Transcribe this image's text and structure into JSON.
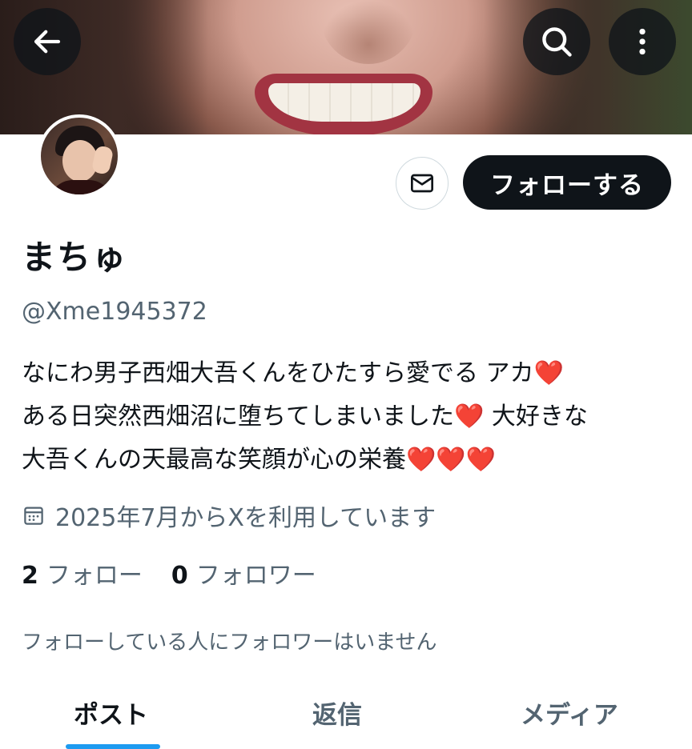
{
  "profile": {
    "name": "まちゅ",
    "handle": "@Xme1945372",
    "follow_button_label": "フォローする",
    "bio_lines": [
      {
        "text": "なにわ男子西畑大吾くんをひたすら愛でる アカ",
        "hearts": "❤️"
      },
      {
        "text": "ある日突然西畑沼に堕ちてしまいました",
        "hearts": "❤️",
        "tail": " 大好きな"
      },
      {
        "text": "大吾くんの天最高な笑顔が心の栄養",
        "hearts": "❤️❤️❤️"
      }
    ],
    "joined": "2025年7月からXを利用しています",
    "following_count": "2",
    "following_label": "フォロー",
    "followers_count": "0",
    "followers_label": "フォロワー",
    "mutual_note": "フォローしている人にフォロワーはいません"
  },
  "tabs": [
    {
      "label": "ポスト",
      "active": true
    },
    {
      "label": "返信",
      "active": false
    },
    {
      "label": "メディア",
      "active": false
    }
  ],
  "colors": {
    "follow_button_bg": "#0f1419",
    "secondary_text": "#536471",
    "tab_indicator": "#1d9bf0",
    "heart": "#e0262f"
  },
  "icons": {
    "back": "back-arrow-icon",
    "search": "search-icon",
    "more": "more-vertical-icon",
    "mail": "mail-icon",
    "calendar": "calendar-icon"
  }
}
